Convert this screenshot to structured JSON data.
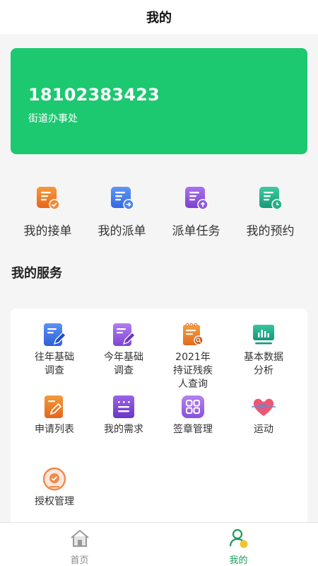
{
  "header": {
    "title": "我的"
  },
  "profile": {
    "phone": "18102383423",
    "org": "街道办事处"
  },
  "colors": {
    "accent": "#1cc870",
    "tab_active": "#1e9b5a"
  },
  "quick_actions": [
    {
      "label": "我的接单",
      "icon": "order-accept-icon",
      "color": "#f07a1f"
    },
    {
      "label": "我的派单",
      "icon": "order-dispatch-icon",
      "color": "#3d7bea"
    },
    {
      "label": "派单任务",
      "icon": "dispatch-task-icon",
      "color": "#8d54db"
    },
    {
      "label": "我的预约",
      "icon": "appointment-icon",
      "color": "#1fb48a"
    }
  ],
  "services_title": "我的服务",
  "services": [
    {
      "label": "往年基础\n调查",
      "icon": "past-survey-icon"
    },
    {
      "label": "今年基础\n调查",
      "icon": "current-survey-icon"
    },
    {
      "label": "2021年\n持证残疾\n人查询",
      "icon": "disability-query-icon"
    },
    {
      "label": "基本数据\n分析",
      "icon": "data-analysis-icon"
    },
    {
      "label": "申请列表",
      "icon": "application-list-icon"
    },
    {
      "label": "我的需求",
      "icon": "my-needs-icon"
    },
    {
      "label": "签章管理",
      "icon": "seal-management-icon"
    },
    {
      "label": "运动",
      "icon": "exercise-heart-icon"
    },
    {
      "label": "授权管理",
      "icon": "authorization-icon"
    }
  ],
  "tabs": [
    {
      "label": "首页",
      "icon": "home-icon",
      "active": false
    },
    {
      "label": "我的",
      "icon": "mine-icon",
      "active": true
    }
  ]
}
